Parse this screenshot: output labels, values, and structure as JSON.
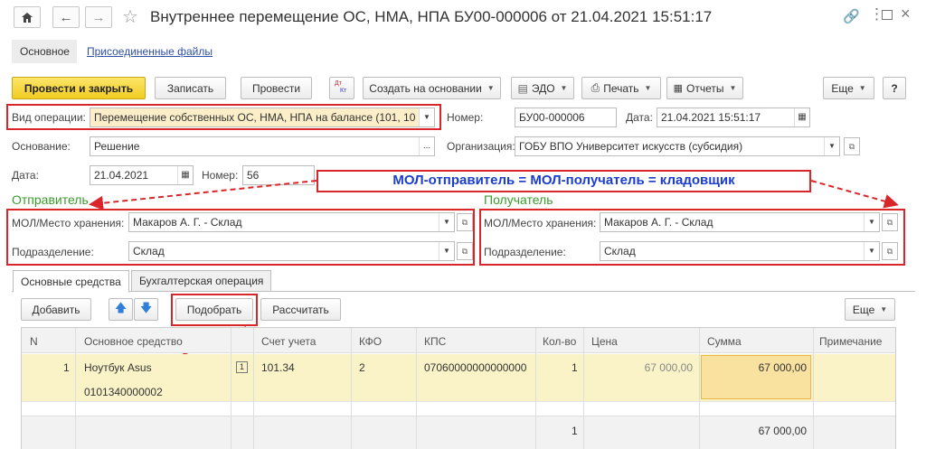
{
  "window": {
    "title": "Внутреннее перемещение ОС, НМА, НПА БУ00-000006 от 21.04.2021 15:51:17"
  },
  "form_tabs": {
    "main": "Основное",
    "files": "Присоединенные файлы"
  },
  "toolbar": {
    "post_close": "Провести и закрыть",
    "save": "Записать",
    "post": "Провести",
    "dtkt_top": "Дт",
    "dtkt_bottom": "Кт",
    "create_based": "Создать на основании",
    "edo": "ЭДО",
    "print": "Печать",
    "reports": "Отчеты",
    "more": "Еще",
    "help": "?"
  },
  "header": {
    "op_label": "Вид операции:",
    "op_value": "Перемещение собственных ОС, НМА, НПА на балансе (101, 10",
    "number_label": "Номер:",
    "number_value": "БУ00-000006",
    "date_label": "Дата:",
    "date_value": "21.04.2021 15:51:17",
    "basis_label": "Основание:",
    "basis_value": "Решение",
    "basis_btn": "...",
    "org_label": "Организация:",
    "org_value": "ГОБУ ВПО Университет искусств (субсидия)",
    "doc_date_label": "Дата:",
    "doc_date_value": "21.04.2021",
    "doc_num_label": "Номер:",
    "doc_num_value": "56"
  },
  "annotation": {
    "text": "МОЛ-отправитель = МОЛ-получатель = кладовщик",
    "color": "#1a3ccf"
  },
  "sender": {
    "title": "Отправитель",
    "mol_label": "МОЛ/Место хранения:",
    "mol_value": "Макаров А. Г. - Склад",
    "dept_label": "Подразделение:",
    "dept_value": "Склад"
  },
  "receiver": {
    "title": "Получатель",
    "mol_label": "МОЛ/Место хранения:",
    "mol_value": "Макаров А. Г. - Склад",
    "dept_label": "Подразделение:",
    "dept_value": "Склад"
  },
  "tabs": {
    "fixed_assets": "Основные средства",
    "accounting": "Бухгалтерская операция"
  },
  "table_toolbar": {
    "add": "Добавить",
    "pick": "Подобрать",
    "calc": "Рассчитать",
    "more": "Еще"
  },
  "table": {
    "columns": [
      "N",
      "Основное средство",
      "Счет учета",
      "КФО",
      "КПС",
      "Кол-во",
      "Цена",
      "Сумма",
      "Примечание"
    ],
    "rows": [
      {
        "n": "1",
        "asset": "Ноутбук Asus",
        "inv": "0101340000002",
        "flag": "1",
        "account": "101.34",
        "kfo": "2",
        "kps": "07060000000000000",
        "qty": "1",
        "price": "67 000,00",
        "sum": "67 000,00",
        "note": ""
      }
    ],
    "footer": {
      "qty": "1",
      "sum": "67 000,00"
    }
  },
  "colors": {
    "primary_button": "#f6d534",
    "highlight_red": "#d9262b",
    "section_green": "#3b9a2d",
    "selected_row": "#fbf3c8",
    "sum_cell": "#f9e2a0",
    "op_field": "#fbeec9"
  }
}
